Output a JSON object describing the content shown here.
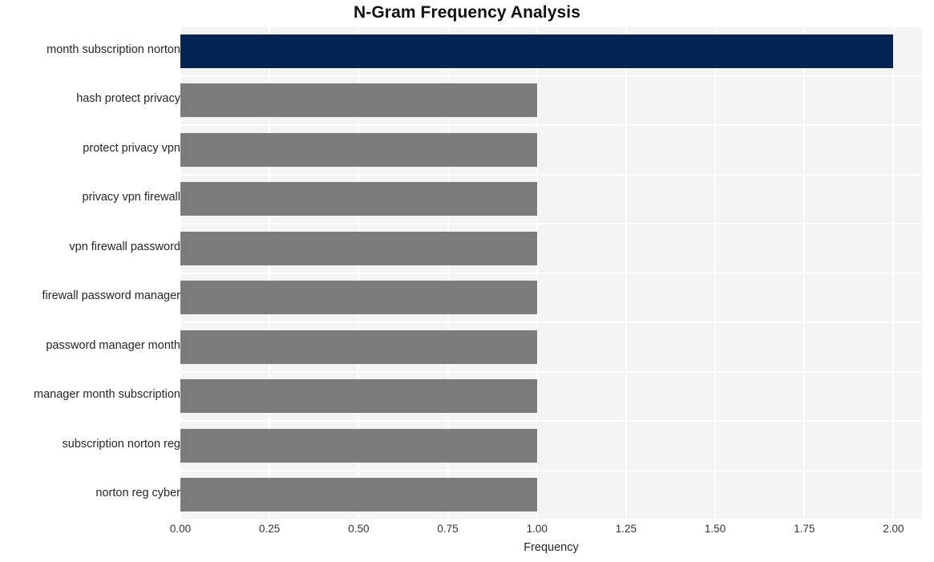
{
  "chart_data": {
    "type": "bar",
    "orientation": "horizontal",
    "title": "N-Gram Frequency Analysis",
    "xlabel": "Frequency",
    "ylabel": "",
    "categories": [
      "month subscription norton",
      "hash protect privacy",
      "protect privacy vpn",
      "privacy vpn firewall",
      "vpn firewall password",
      "firewall password manager",
      "password manager month",
      "manager month subscription",
      "subscription norton reg",
      "norton reg cyber"
    ],
    "values": [
      2,
      1,
      1,
      1,
      1,
      1,
      1,
      1,
      1,
      1
    ],
    "bar_colors": [
      "#032352",
      "#7b7c79",
      "#7b7c79",
      "#7b7c79",
      "#7b7c79",
      "#7b7c79",
      "#7b7c79",
      "#7b7c79",
      "#7b7c79",
      "#7b7c79"
    ],
    "xlim": [
      0,
      2.08
    ],
    "xticks": [
      0,
      0.25,
      0.5,
      0.75,
      1,
      1.25,
      1.5,
      1.75,
      2
    ],
    "xtick_labels": [
      "0.00",
      "0.25",
      "0.50",
      "0.75",
      "1.00",
      "1.25",
      "1.50",
      "1.75",
      "2.00"
    ],
    "grid": true,
    "grid_color": "#ffffff",
    "plot_background": "#f4f4f4",
    "figure_background": "#ffffff",
    "legend": null,
    "highlight_color": "#032352",
    "base_color": "#7b7c79"
  }
}
